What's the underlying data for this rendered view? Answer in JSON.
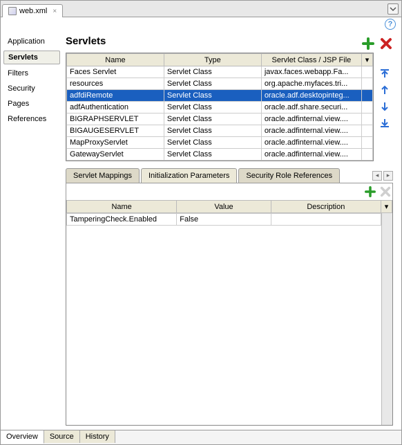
{
  "tab": {
    "title": "web.xml"
  },
  "sidebar": {
    "items": [
      {
        "label": "Application"
      },
      {
        "label": "Servlets"
      },
      {
        "label": "Filters"
      },
      {
        "label": "Security"
      },
      {
        "label": "Pages"
      },
      {
        "label": "References"
      }
    ],
    "selected_index": 1
  },
  "main": {
    "title": "Servlets",
    "table": {
      "columns": [
        "Name",
        "Type",
        "Servlet Class / JSP File"
      ],
      "rows": [
        {
          "name": "Faces Servlet",
          "type": "Servlet Class",
          "class": "javax.faces.webapp.Fa..."
        },
        {
          "name": "resources",
          "type": "Servlet Class",
          "class": "org.apache.myfaces.tri..."
        },
        {
          "name": "adfdiRemote",
          "type": "Servlet Class",
          "class": "oracle.adf.desktopinteg..."
        },
        {
          "name": "adfAuthentication",
          "type": "Servlet Class",
          "class": "oracle.adf.share.securi..."
        },
        {
          "name": "BIGRAPHSERVLET",
          "type": "Servlet Class",
          "class": "oracle.adfinternal.view...."
        },
        {
          "name": "BIGAUGESERVLET",
          "type": "Servlet Class",
          "class": "oracle.adfinternal.view...."
        },
        {
          "name": "MapProxyServlet",
          "type": "Servlet Class",
          "class": "oracle.adfinternal.view...."
        },
        {
          "name": "GatewayServlet",
          "type": "Servlet Class",
          "class": "oracle.adfinternal.view...."
        }
      ],
      "selected_index": 2
    },
    "sub_tabs": {
      "items": [
        "Servlet Mappings",
        "Initialization Parameters",
        "Security Role References"
      ],
      "selected_index": 1
    },
    "params_table": {
      "columns": [
        "Name",
        "Value",
        "Description"
      ],
      "rows": [
        {
          "name": "TamperingCheck.Enabled",
          "value": "False",
          "description": ""
        }
      ]
    }
  },
  "bottom_tabs": {
    "items": [
      "Overview",
      "Source",
      "History"
    ],
    "selected_index": 0
  }
}
